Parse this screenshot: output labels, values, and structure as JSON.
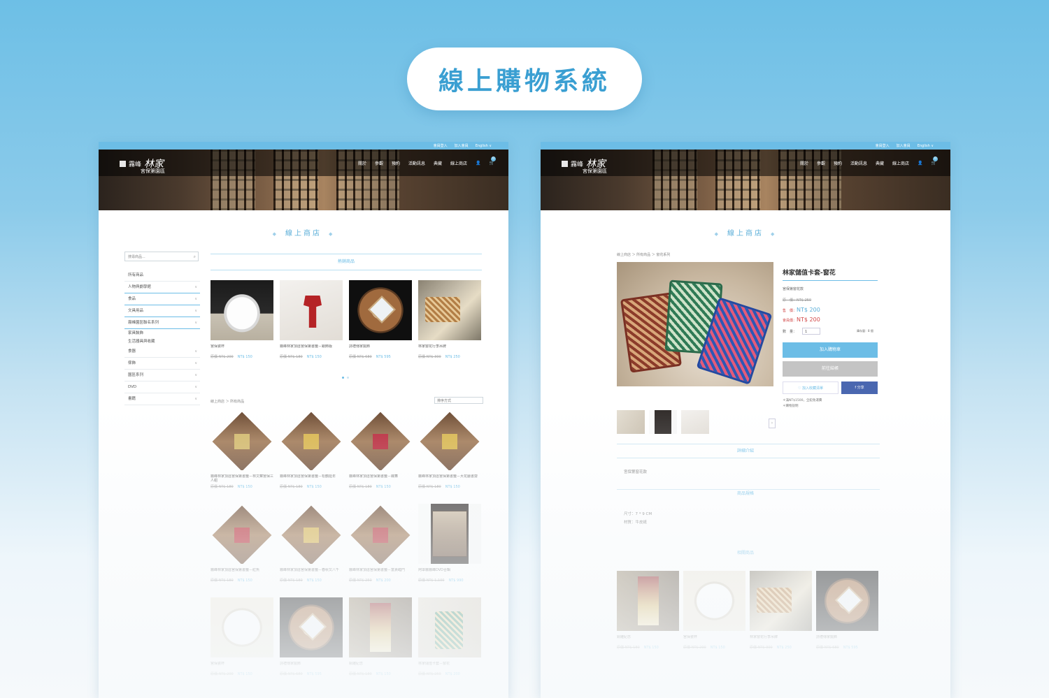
{
  "banner": {
    "title": "線上購物系統"
  },
  "header": {
    "top_links": [
      "會員登入",
      "加入會員",
      "English ∨"
    ],
    "logo_line1": "霧峰",
    "logo_line2": "林家",
    "logo_sub": "宮保第園區",
    "nav": [
      "關於",
      "參觀",
      "預約",
      "活動訊息",
      "典藏",
      "線上商店"
    ],
    "cart_count": "0"
  },
  "left_page": {
    "section_title": "線上商店",
    "search_placeholder": "搜尋商品...",
    "sidebar": [
      {
        "label": "所有商品",
        "chevron": false,
        "highlight": false
      },
      {
        "label": "人物與劇學館",
        "chevron": true,
        "highlight": true
      },
      {
        "label": "食品",
        "chevron": true,
        "highlight": true
      },
      {
        "label": "文具用品",
        "chevron": true,
        "highlight": true
      },
      {
        "label": "霧峰園區聯名系列",
        "chevron": true,
        "highlight": true
      },
      {
        "label": "家具裝飾",
        "chevron": false,
        "highlight": false
      },
      {
        "label": "生活器具與收藏",
        "chevron": false,
        "highlight": false
      },
      {
        "label": "食器",
        "chevron": true,
        "highlight": false
      },
      {
        "label": "傢飾",
        "chevron": true,
        "highlight": false
      },
      {
        "label": "園區系列",
        "chevron": true,
        "highlight": false
      },
      {
        "label": "DVD",
        "chevron": true,
        "highlight": false
      },
      {
        "label": "書籍",
        "chevron": true,
        "highlight": false
      }
    ],
    "hot_label": "熱銷商品",
    "hot_products": [
      {
        "name": "宮保瓷杯",
        "old": "原價 NT$ 200",
        "price": "NT$ 150",
        "img": "bowl"
      },
      {
        "name": "霧峰林家頂厝宮保第書籤－銀飾版",
        "old": "原價 NT$ 180",
        "price": "NT$ 150",
        "img": "paper"
      },
      {
        "name": "詩禮傳家擺飾",
        "old": "原價 NT$ 680",
        "price": "NT$ 595",
        "img": "wood"
      },
      {
        "name": "林家窗花行李吊牌",
        "old": "原價 NT$ 300",
        "price": "NT$ 250",
        "img": "tag"
      }
    ],
    "breadcrumb": "線上商店 ＞ 所有商品",
    "sort_label": "排序方式",
    "products": [
      {
        "name": "霧峰林家頂厝宮保第書籤－林文察宮保三人組",
        "old": "原價 NT$ 180",
        "price": "NT$ 150",
        "img": "tile",
        "color": "#d2b86a"
      },
      {
        "name": "霧峰林家頂厝宮保第書籤－松鶴延年",
        "old": "原價 NT$ 180",
        "price": "NT$ 150",
        "img": "tile",
        "color": "#d8b44a"
      },
      {
        "name": "霧峰林家頂厝宮保第書籤－蝶舞",
        "old": "原價 NT$ 180",
        "price": "NT$ 150",
        "img": "tile",
        "color": "#b8283a"
      },
      {
        "name": "霧峰林家頂厝宮保第書籤－大花廳書齋",
        "old": "原價 NT$ 180",
        "price": "NT$ 150",
        "img": "tile",
        "color": "#d7b54c"
      },
      {
        "name": "霧峰林家頂厝宮保第書籤－紅魚",
        "old": "原價 NT$ 180",
        "price": "NT$ 150",
        "img": "tile",
        "color": "#b52a34"
      },
      {
        "name": "霧峰林家頂厝宮保第書籤－春秋又八千",
        "old": "原價 NT$ 180",
        "price": "NT$ 150",
        "img": "tile",
        "color": "#d4b04a"
      },
      {
        "name": "霧峰林家頂厝宮保第書籤－富貴臨門",
        "old": "原價 NT$ 250",
        "price": "NT$ 200",
        "img": "tile",
        "color": "#b3323a"
      },
      {
        "name": "阿罩霧霧峰DVD合輯",
        "old": "原價 NT$ 1,100",
        "price": "NT$ 990",
        "img": "book",
        "color": ""
      },
      {
        "name": "宮保瓷杯",
        "old": "原價 NT$ 200",
        "price": "NT$ 150",
        "img": "bowlw",
        "color": ""
      },
      {
        "name": "詩禮傳家擺飾",
        "old": "原價 NT$ 680",
        "price": "NT$ 595",
        "img": "wood",
        "color": ""
      },
      {
        "name": "銅雕紀念",
        "old": "原價 NT$ 180",
        "price": "NT$ 150",
        "img": "goldbook",
        "color": ""
      },
      {
        "name": "林家儲值卡套－窗花",
        "old": "原價 NT$ 250",
        "price": "NT$ 200",
        "img": "colorcard",
        "color": ""
      }
    ]
  },
  "right_page": {
    "section_title": "線上商店",
    "breadcrumb": "線上商店 ＞ 所有商品 ＞ 窗花系列",
    "product_title": "林家儲值卡套-窗花",
    "subtitle": "宮保第窗花款",
    "list_price": "原　價：NT$ 250",
    "sale_label": "售　價：",
    "sale_price": "NT$ 200",
    "member_label": "會員價：",
    "member_price": "NT$ 200",
    "qty_label": "數　量：",
    "qty_value": "1",
    "stock": "庫存量：8 個",
    "add_cart": "加入購物車",
    "checkout": "前往結帳",
    "favorite": "♡ 加入收藏清單",
    "share": "f 分享",
    "note1": "＊滿NT$1500，全館免運費",
    "note2": "＊購物說明",
    "detail_label": "詳細介紹",
    "detail_text": "宮保第窗花款",
    "spec_label": "商品規格",
    "spec_size": "尺寸：7 * 9 CM",
    "spec_material": "材質：牛皮紙",
    "related_label": "相關商品",
    "related": [
      {
        "name": "銅雕紀念",
        "old": "原價 NT$ 180",
        "price": "NT$ 150",
        "img": "goldbook"
      },
      {
        "name": "宮保瓷杯",
        "old": "原價 NT$ 200",
        "price": "NT$ 150",
        "img": "bowlw"
      },
      {
        "name": "林家窗花行李吊牌",
        "old": "原價 NT$ 300",
        "price": "NT$ 250",
        "img": "tag"
      },
      {
        "name": "詩禮傳家擺飾",
        "old": "原價 NT$ 680",
        "price": "NT$ 595",
        "img": "wood"
      }
    ]
  }
}
